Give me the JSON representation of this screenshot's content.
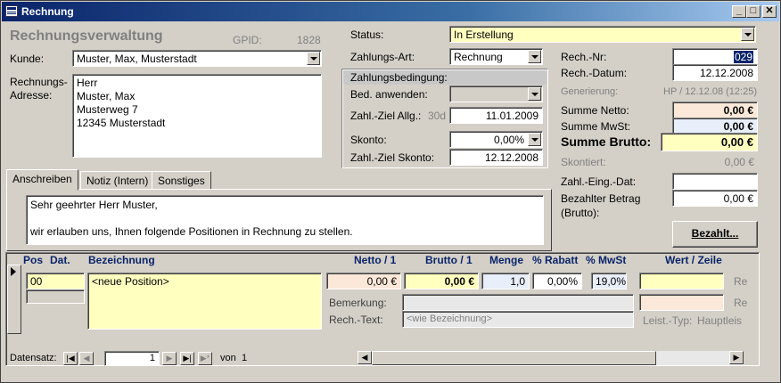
{
  "window": {
    "title": "Rechnung",
    "minimize": "_",
    "maximize": "□",
    "close": "✕"
  },
  "header": {
    "title": "Rechnungsverwaltung",
    "gpid_label": "GPID:",
    "gpid_value": "1828"
  },
  "customer": {
    "label": "Kunde:",
    "value": "Muster, Max, Musterstadt",
    "address_label_1": "Rechnungs-",
    "address_label_2": "Adresse:",
    "address_lines": [
      "Herr",
      "Muster, Max",
      "Musterweg 7",
      "12345 Musterstadt"
    ]
  },
  "status": {
    "label": "Status:",
    "value": "In Erstellung"
  },
  "payment": {
    "type_label": "Zahlungs-Art:",
    "type_value": "Rechnung",
    "conditions_title": "Zahlungsbedingung:",
    "apply_label": "Bed. anwenden:",
    "apply_value": "",
    "due_label": "Zahl.-Ziel Allg.:",
    "due_days": "30d",
    "due_value": "11.01.2009",
    "skonto_label": "Skonto:",
    "skonto_value": "0,00%",
    "skonto_due_label": "Zahl.-Ziel Skonto:",
    "skonto_due_value": "12.12.2008"
  },
  "invoice": {
    "nr_label": "Rech.-Nr:",
    "nr_value": "029",
    "date_label": "Rech.-Datum:",
    "date_value": "12.12.2008",
    "gen_label": "Generierung:",
    "gen_value": "HP / 12.12.08 (12:25)",
    "sum_net_label": "Summe Netto:",
    "sum_net_value": "0,00 €",
    "sum_vat_label": "Summe MwSt:",
    "sum_vat_value": "0,00 €",
    "sum_gross_label": "Summe Brutto:",
    "sum_gross_value": "0,00 €",
    "discounted_label": "Skontiert:",
    "discounted_value": "0,00 €",
    "pay_date_label": "Zahl.-Eing.-Dat:",
    "pay_date_value": "",
    "paid_label_1": "Bezahlter Betrag",
    "paid_label_2": "(Brutto):",
    "paid_value": "0,00 €",
    "paid_button": "Bezahlt..."
  },
  "tabs": [
    {
      "label": "Anschreiben"
    },
    {
      "label": "Notiz (Intern)"
    },
    {
      "label": "Sonstiges"
    }
  ],
  "letter": {
    "line1": "Sehr geehrter Herr Muster,",
    "line2": "wir erlauben uns, Ihnen folgende Positionen in Rechnung zu stellen."
  },
  "positions": {
    "headers": {
      "pos": "Pos",
      "dat": "Dat.",
      "desc": "Bezeichnung",
      "net": "Netto / 1",
      "gross": "Brutto / 1",
      "qty": "Menge",
      "discount": "% Rabatt",
      "vat": "% MwSt",
      "value": "Wert / Zeile"
    },
    "row": {
      "pos": "00",
      "desc": "<neue Position>",
      "net": "0,00 €",
      "gross": "0,00 €",
      "qty": "1,0",
      "discount": "0,00%",
      "vat": "19,0%",
      "remark_label": "Bemerkung:",
      "text_label": "Rech.-Text:",
      "text_value": "<wie Bezeichnung>",
      "service_type_label": "Leist.-Typ:",
      "service_type_value": "Hauptleis",
      "re_1": "Re",
      "re_2": "Re"
    }
  },
  "navigation": {
    "label": "Datensatz:",
    "current": "1",
    "of_label": "von",
    "total": "1",
    "first": "|◀",
    "prev": "◀",
    "next": "▶",
    "last": "▶|",
    "new": "▶*"
  }
}
